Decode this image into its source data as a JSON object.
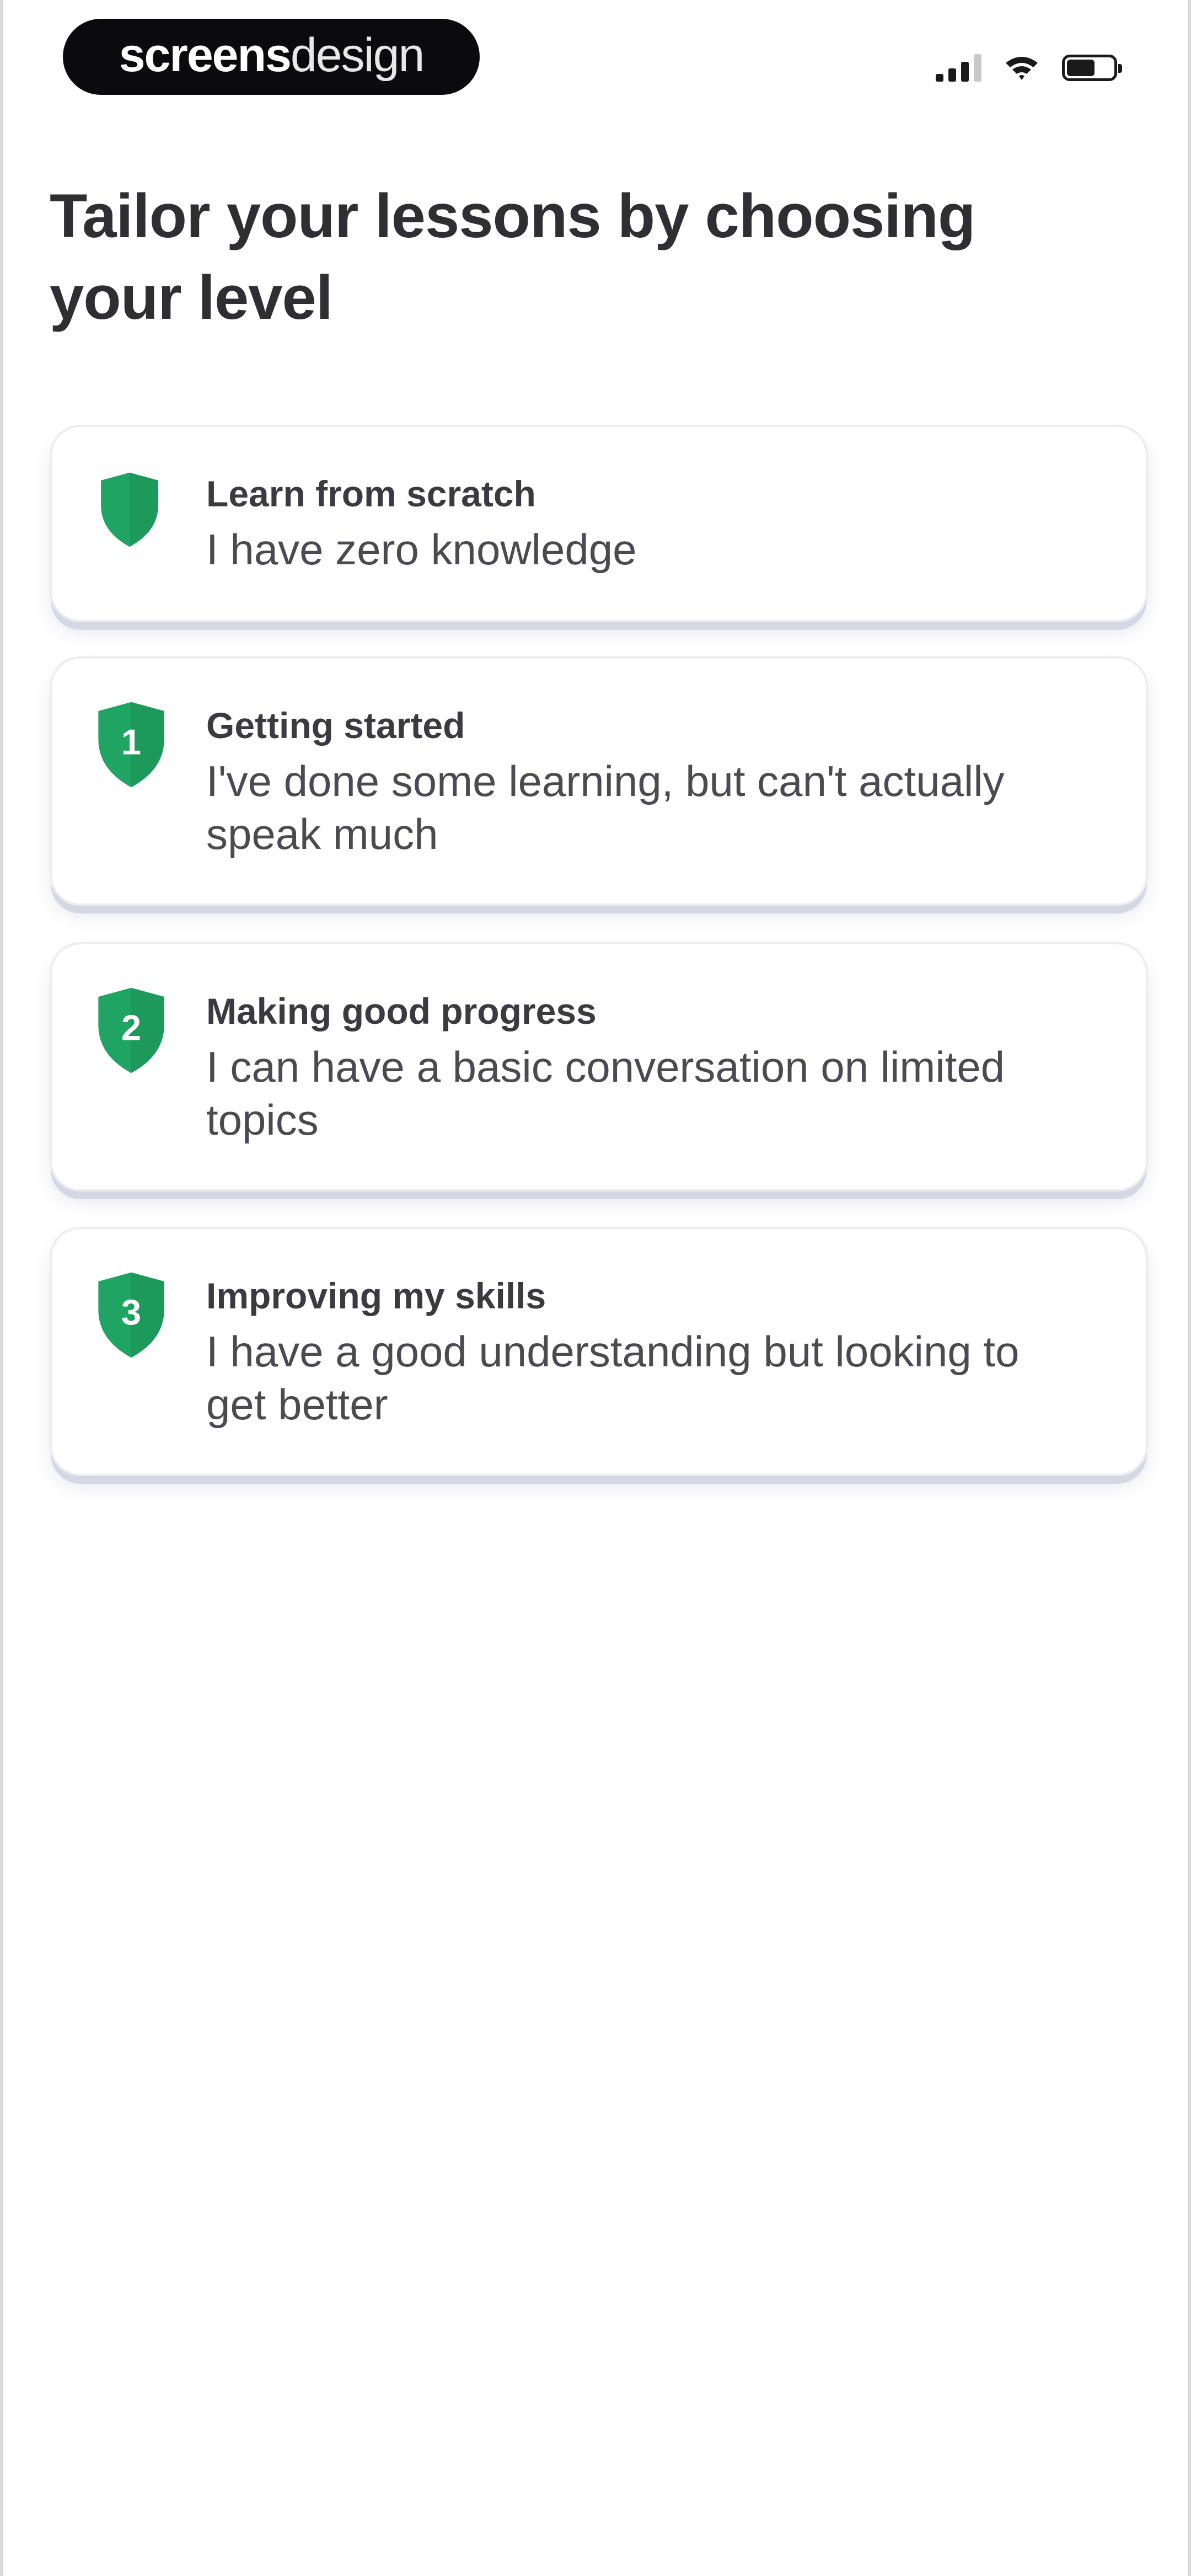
{
  "status_bar": {
    "brand_bold": "screens",
    "brand_light": "design",
    "icons": [
      "signal-icon",
      "wifi-icon",
      "battery-icon"
    ]
  },
  "header": {
    "title": "Tailor your lessons by choosing your level"
  },
  "levels": [
    {
      "icon": "shield-icon",
      "badge": "",
      "title": "Learn from scratch",
      "description": "I have zero knowledge"
    },
    {
      "icon": "shield-one-icon",
      "badge": "1",
      "title": "Getting started",
      "description": "I've done some learning, but can't actually speak much"
    },
    {
      "icon": "shield-two-icon",
      "badge": "2",
      "title": "Making good progress",
      "description": "I can have a basic conversation on limited topics"
    },
    {
      "icon": "shield-three-icon",
      "badge": "3",
      "title": "Improving my skills",
      "description": "I have a good understanding but looking to get better"
    }
  ],
  "colors": {
    "accent_green": "#1fa463",
    "card_border": "#ececf1",
    "card_shadow": "#d6d7e4",
    "title_text": "#2f2f33"
  }
}
